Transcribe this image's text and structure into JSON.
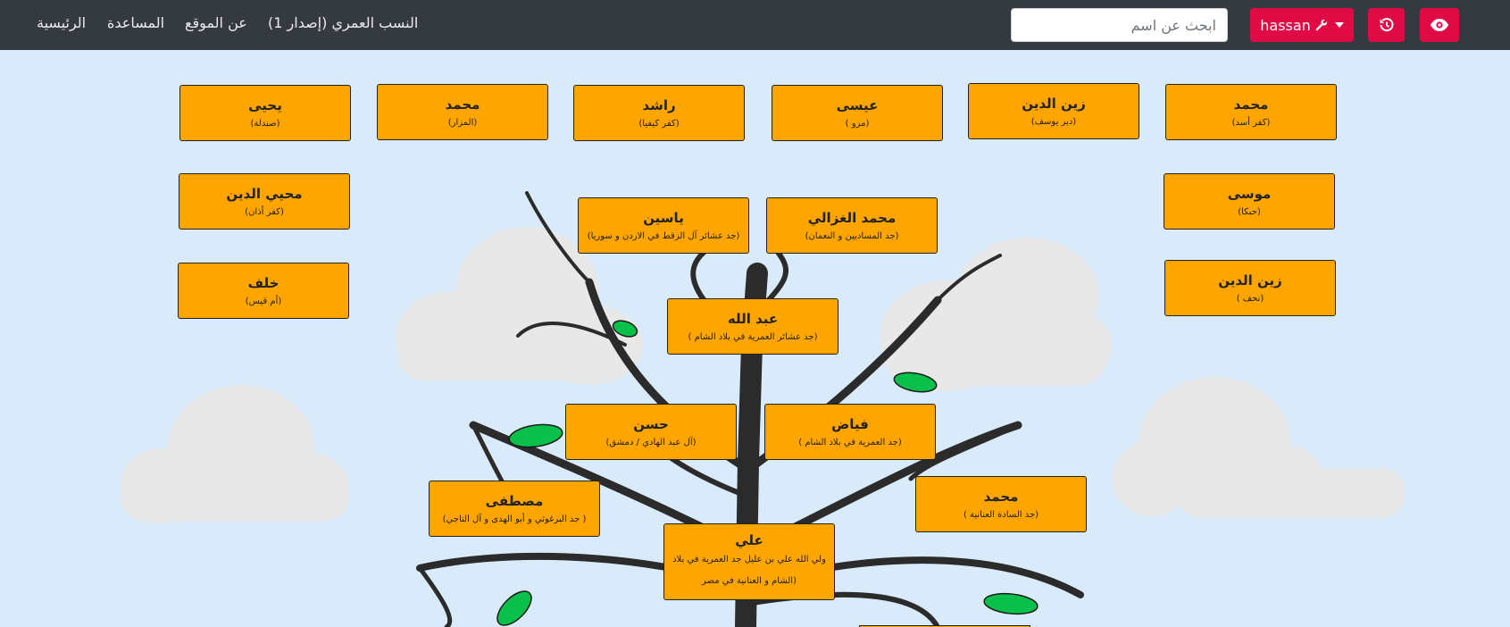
{
  "navbar": {
    "brand": "النسب العمري (إصدار 1)",
    "links": [
      "عن الموقع",
      "المساعدة",
      "الرئيسية"
    ],
    "search_placeholder": "ابحث عن اسم",
    "user_label": "hassan",
    "colors": {
      "bar": "#343a40",
      "accent": "#e00b45"
    }
  },
  "tree": {
    "colors": {
      "sky": "#d9ebfb",
      "node": "#ffa500",
      "trunk": "#2b2b2b",
      "leaf": "#08c04a",
      "cloud": "#e8e8e8"
    },
    "nodes": [
      {
        "name": "يحيى",
        "desc": "(صندلة)"
      },
      {
        "name": "محمد",
        "desc": "(المزار)"
      },
      {
        "name": "راشد",
        "desc": "(كفر كيفيا)"
      },
      {
        "name": "عيسى",
        "desc": "(مرو )"
      },
      {
        "name": "زين الدين",
        "desc": "(دير يوسف)"
      },
      {
        "name": "محمد",
        "desc": "(كفر أسد)"
      },
      {
        "name": "محيي الدين",
        "desc": "(كفر أذان)"
      },
      {
        "name": "موسى",
        "desc": "(حبكا)"
      },
      {
        "name": "ياسين",
        "desc": "(جد عشائر آل الزقط في الاردن و سوريا)"
      },
      {
        "name": "محمد الغزالي",
        "desc": "(جد المساديين و النعمان)"
      },
      {
        "name": "خلف",
        "desc": "(أم قيس)"
      },
      {
        "name": "زين الدين",
        "desc": "(نحف )"
      },
      {
        "name": "عبد الله",
        "desc": "(جد عشائر العمرية في بلاد الشام )"
      },
      {
        "name": "حسن",
        "desc": "(آل عبد الهادي / دمشق)"
      },
      {
        "name": "فياض",
        "desc": "(جد العمرية في بلاد الشام )"
      },
      {
        "name": "مصطفى",
        "desc": "( جد البرغوثي و أبو الهدى و آل التاجي)"
      },
      {
        "name": "محمد",
        "desc": "(جد السادة العنانية )"
      },
      {
        "name": "علي",
        "desc": "ولي الله علي بن عليل جد العمرية في بلاد (الشام و العنانية في مصر"
      }
    ]
  }
}
